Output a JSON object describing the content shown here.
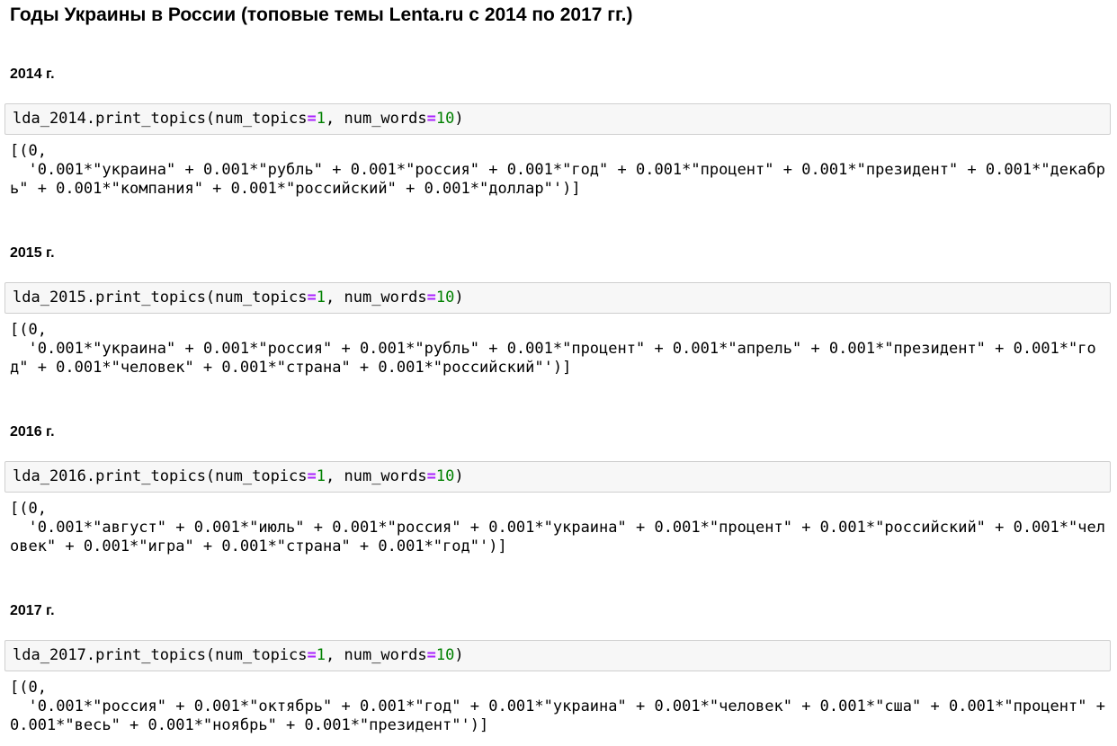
{
  "page": {
    "title": "Годы Украины в России (топовые темы Lenta.ru с 2014 по 2017 гг.)"
  },
  "colors": {
    "number_token": "#008000",
    "operator_token": "#aa22ff",
    "cell_background": "#f7f7f7",
    "cell_border": "#cfcfcf"
  },
  "sections": [
    {
      "heading": "2014 г.",
      "code": {
        "prefix": "lda_2014.print_topics(num_topics",
        "op1": "=",
        "num1": "1",
        "mid": ", num_words",
        "op2": "=",
        "num2": "10",
        "suffix": ")"
      },
      "output": "[(0,\n  '0.001*\"украина\" + 0.001*\"рубль\" + 0.001*\"россия\" + 0.001*\"год\" + 0.001*\"процент\" + 0.001*\"президент\" + 0.001*\"декабрь\" + 0.001*\"компания\" + 0.001*\"российский\" + 0.001*\"доллар\"')]"
    },
    {
      "heading": "2015 г.",
      "code": {
        "prefix": "lda_2015.print_topics(num_topics",
        "op1": "=",
        "num1": "1",
        "mid": ", num_words",
        "op2": "=",
        "num2": "10",
        "suffix": ")"
      },
      "output": "[(0,\n  '0.001*\"украина\" + 0.001*\"россия\" + 0.001*\"рубль\" + 0.001*\"процент\" + 0.001*\"апрель\" + 0.001*\"президент\" + 0.001*\"год\" + 0.001*\"человек\" + 0.001*\"страна\" + 0.001*\"российский\"')]"
    },
    {
      "heading": "2016 г.",
      "code": {
        "prefix": "lda_2016.print_topics(num_topics",
        "op1": "=",
        "num1": "1",
        "mid": ", num_words",
        "op2": "=",
        "num2": "10",
        "suffix": ")"
      },
      "output": "[(0,\n  '0.001*\"август\" + 0.001*\"июль\" + 0.001*\"россия\" + 0.001*\"украина\" + 0.001*\"процент\" + 0.001*\"российский\" + 0.001*\"человек\" + 0.001*\"игра\" + 0.001*\"страна\" + 0.001*\"год\"')]"
    },
    {
      "heading": "2017 г.",
      "code": {
        "prefix": "lda_2017.print_topics(num_topics",
        "op1": "=",
        "num1": "1",
        "mid": ", num_words",
        "op2": "=",
        "num2": "10",
        "suffix": ")"
      },
      "output": "[(0,\n  '0.001*\"россия\" + 0.001*\"октябрь\" + 0.001*\"год\" + 0.001*\"украина\" + 0.001*\"человек\" + 0.001*\"сша\" + 0.001*\"процент\" + 0.001*\"весь\" + 0.001*\"ноябрь\" + 0.001*\"президент\"')]"
    }
  ]
}
